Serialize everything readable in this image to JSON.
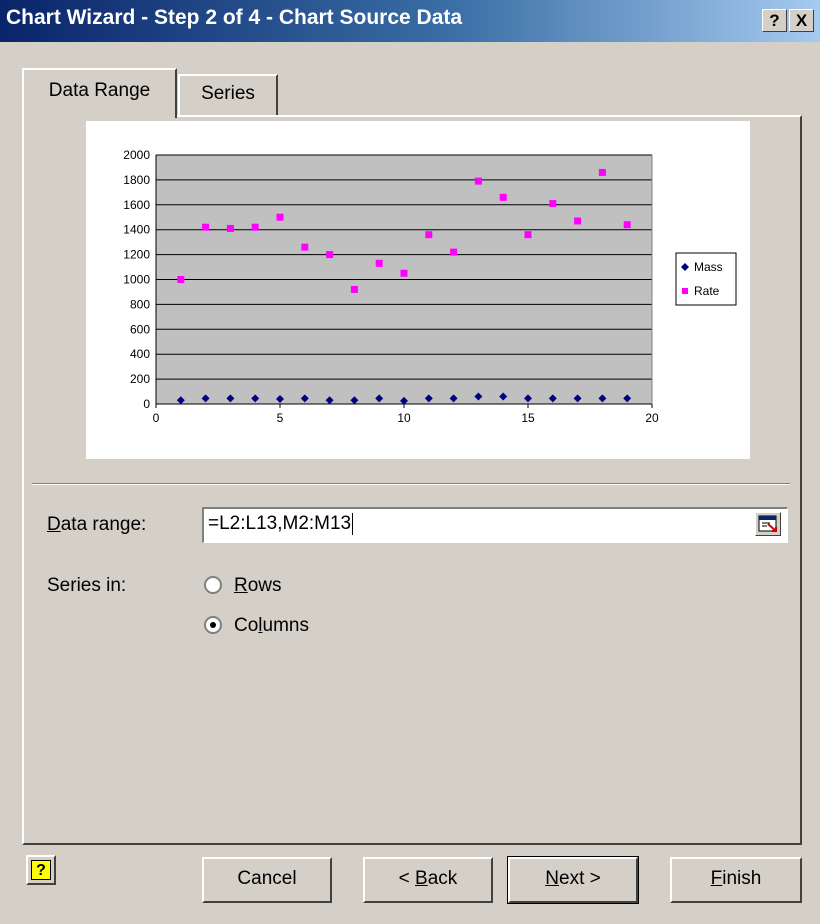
{
  "window": {
    "title": "Chart Wizard - Step 2 of 4 - Chart Source Data",
    "help_glyph": "?",
    "close_glyph": "X"
  },
  "tabs": [
    {
      "label": "Data Range",
      "selected": true
    },
    {
      "label": "Series",
      "selected": false
    }
  ],
  "chart_data": {
    "type": "scatter",
    "xlim": [
      0,
      20
    ],
    "ylim": [
      0,
      2000
    ],
    "x_ticks": [
      "0",
      "5",
      "10",
      "15",
      "20"
    ],
    "y_ticks": [
      "0",
      "200",
      "400",
      "600",
      "800",
      "1000",
      "1200",
      "1400",
      "1600",
      "1800",
      "2000"
    ],
    "grid": true,
    "legend_position": "right",
    "series": [
      {
        "name": "Mass",
        "color": "#000080",
        "marker": "diamond",
        "points": [
          [
            1,
            30
          ],
          [
            2,
            45
          ],
          [
            3,
            45
          ],
          [
            4,
            45
          ],
          [
            5,
            40
          ],
          [
            6,
            45
          ],
          [
            7,
            30
          ],
          [
            8,
            30
          ],
          [
            9,
            45
          ],
          [
            10,
            25
          ],
          [
            11,
            45
          ],
          [
            12,
            45
          ],
          [
            13,
            60
          ],
          [
            14,
            60
          ],
          [
            15,
            45
          ],
          [
            16,
            45
          ],
          [
            17,
            45
          ],
          [
            18,
            45
          ],
          [
            19,
            45
          ]
        ]
      },
      {
        "name": "Rate",
        "color": "#ff00ff",
        "marker": "square",
        "points": [
          [
            1,
            1000
          ],
          [
            2,
            1420
          ],
          [
            3,
            1410
          ],
          [
            4,
            1420
          ],
          [
            5,
            1500
          ],
          [
            6,
            1260
          ],
          [
            7,
            1200
          ],
          [
            8,
            920
          ],
          [
            9,
            1130
          ],
          [
            10,
            1050
          ],
          [
            11,
            1360
          ],
          [
            12,
            1220
          ],
          [
            13,
            1790
          ],
          [
            14,
            1660
          ],
          [
            15,
            1360
          ],
          [
            16,
            1610
          ],
          [
            17,
            1470
          ],
          [
            18,
            1860
          ],
          [
            19,
            1440
          ]
        ]
      }
    ]
  },
  "data_range": {
    "label_prefix": "D",
    "label_rest": "ata range:",
    "value": "=L2:L13,M2:M13"
  },
  "series_in": {
    "label": "Series in:",
    "options": [
      {
        "label_prefix": "",
        "label_ul": "R",
        "label_rest": "ows",
        "checked": false
      },
      {
        "label_prefix": "Co",
        "label_ul": "l",
        "label_rest": "umns",
        "checked": true
      }
    ]
  },
  "buttons": {
    "help_glyph": "?",
    "cancel": "Cancel",
    "back_prefix": "< ",
    "back_ul": "B",
    "back_rest": "ack",
    "next_prefix": "",
    "next_ul": "N",
    "next_rest": "ext >",
    "finish_ul": "F",
    "finish_rest": "inish"
  }
}
